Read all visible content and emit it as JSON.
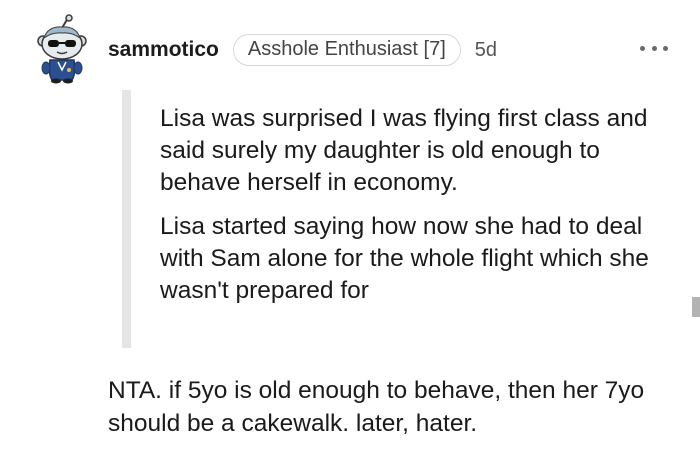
{
  "comment": {
    "username": "sammotico",
    "flair": "Asshole Enthusiast [7]",
    "age": "5d",
    "quote_paragraphs": [
      "Lisa was surprised I was flying first class and said surely my daughter is old enough to behave herself in economy.",
      "Lisa started saying how now she had to deal with Sam alone for the whole flight which she wasn't prepared for"
    ],
    "body": "NTA. if 5yo is old enough to behave, then her 7yo should be a cakewalk. later, hater."
  },
  "icons": {
    "avatar": "snoo-avatar-sunglasses",
    "menu": "more-options-icon"
  },
  "colors": {
    "text": "#1a1a1b",
    "quote_bar": "#e5e5e5",
    "flair_border": "#d7d7d7"
  }
}
